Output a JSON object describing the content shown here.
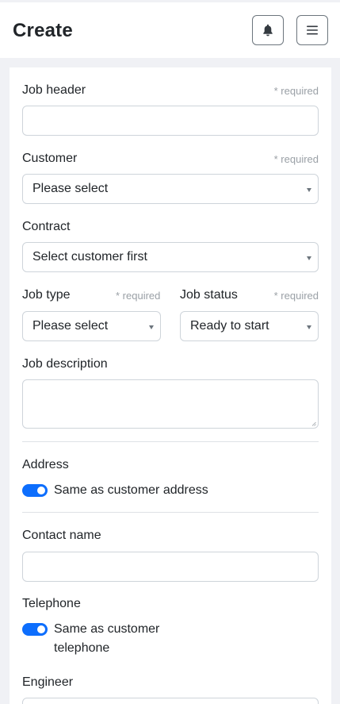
{
  "header": {
    "title": "Create",
    "bell_icon": "bell-icon",
    "menu_icon": "hamburger-menu-icon"
  },
  "form": {
    "job_header": {
      "label": "Job header",
      "required": "* required",
      "value": ""
    },
    "customer": {
      "label": "Customer",
      "required": "* required",
      "value": "Please select"
    },
    "contract": {
      "label": "Contract",
      "value": "Select customer first"
    },
    "job_type": {
      "label": "Job type",
      "required": "* required",
      "value": "Please select"
    },
    "job_status": {
      "label": "Job status",
      "required": "* required",
      "value": "Ready to start"
    },
    "job_description": {
      "label": "Job description",
      "value": ""
    },
    "address": {
      "label": "Address",
      "toggle_label": "Same as customer address",
      "toggle_on": true
    },
    "contact_name": {
      "label": "Contact name",
      "value": ""
    },
    "telephone": {
      "label": "Telephone",
      "toggle_label_line1": "Same as customer",
      "toggle_label_line2": "telephone",
      "toggle_on": true
    },
    "engineer": {
      "label": "Engineer"
    }
  },
  "colors": {
    "accent": "#0d6efd",
    "page_bg": "#f0f1f5",
    "required_text": "#9aa0a6"
  }
}
